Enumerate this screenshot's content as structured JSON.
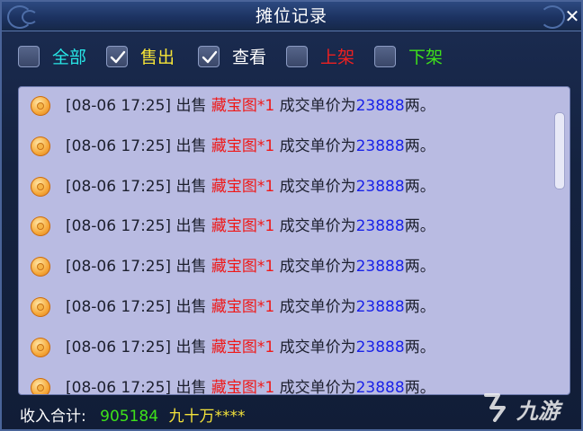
{
  "window": {
    "title": "摊位记录",
    "close_glyph": "✕"
  },
  "filters": [
    {
      "label": "全部",
      "checked": false,
      "color": "#27e6e6"
    },
    {
      "label": "售出",
      "checked": true,
      "color": "#f6e437"
    },
    {
      "label": "查看",
      "checked": true,
      "color": "#ffffff"
    },
    {
      "label": "上架",
      "checked": false,
      "color": "#ef2020"
    },
    {
      "label": "下架",
      "checked": false,
      "color": "#3ee21a"
    }
  ],
  "records": [
    {
      "time": "[08-06 17:25]",
      "action": "出售",
      "item": "藏宝图*1",
      "deal": "成交单价为",
      "price": "23888",
      "unit": "两。"
    },
    {
      "time": "[08-06 17:25]",
      "action": "出售",
      "item": "藏宝图*1",
      "deal": "成交单价为",
      "price": "23888",
      "unit": "两。"
    },
    {
      "time": "[08-06 17:25]",
      "action": "出售",
      "item": "藏宝图*1",
      "deal": "成交单价为",
      "price": "23888",
      "unit": "两。"
    },
    {
      "time": "[08-06 17:25]",
      "action": "出售",
      "item": "藏宝图*1",
      "deal": "成交单价为",
      "price": "23888",
      "unit": "两。"
    },
    {
      "time": "[08-06 17:25]",
      "action": "出售",
      "item": "藏宝图*1",
      "deal": "成交单价为",
      "price": "23888",
      "unit": "两。"
    },
    {
      "time": "[08-06 17:25]",
      "action": "出售",
      "item": "藏宝图*1",
      "deal": "成交单价为",
      "price": "23888",
      "unit": "两。"
    },
    {
      "time": "[08-06 17:25]",
      "action": "出售",
      "item": "藏宝图*1",
      "deal": "成交单价为",
      "price": "23888",
      "unit": "两。"
    },
    {
      "time": "[08-06 17:25]",
      "action": "出售",
      "item": "藏宝图*1",
      "deal": "成交单价为",
      "price": "23888",
      "unit": "两。"
    }
  ],
  "footer": {
    "label": "收入合计:",
    "total": "905184",
    "total_words": "九十万****"
  },
  "watermark": {
    "text": "九游"
  },
  "colors": {
    "price_blue": "#1a22e8",
    "item_red": "#ef1818",
    "list_bg": "#b9bbe2"
  }
}
